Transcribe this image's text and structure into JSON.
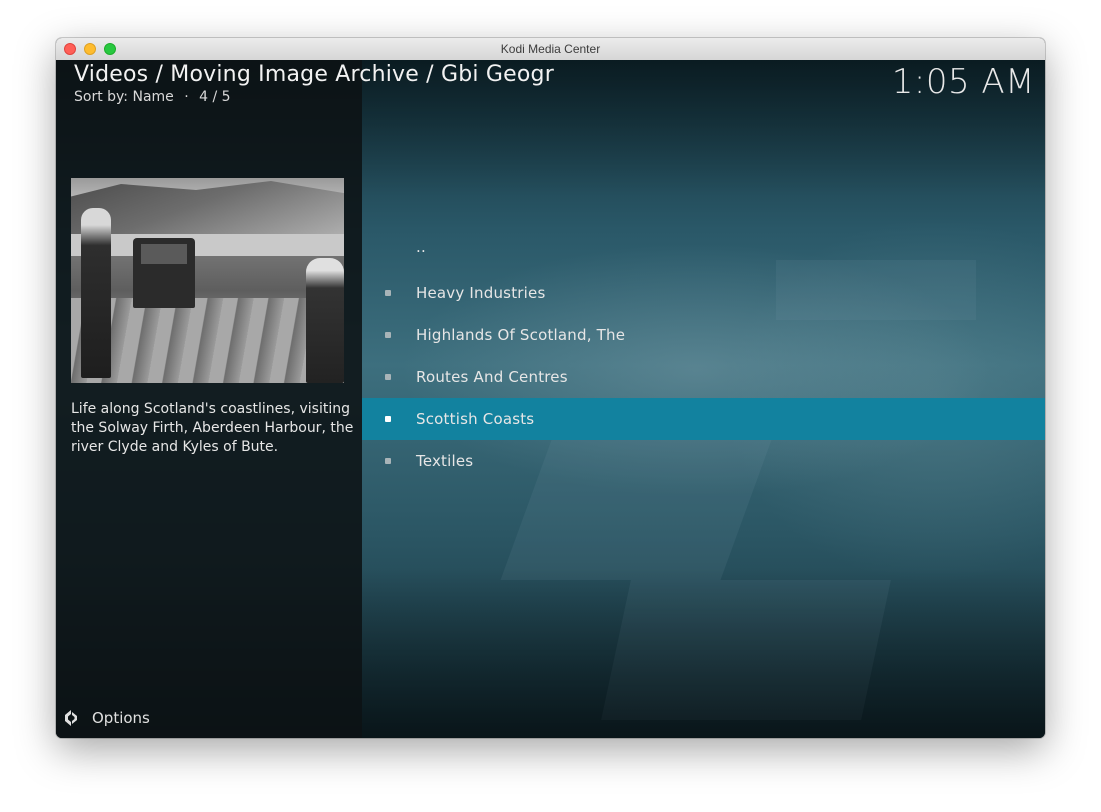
{
  "window": {
    "title": "Kodi Media Center"
  },
  "header": {
    "breadcrumb": "Videos / Moving Image Archive / Gbi Geogr",
    "sort_label": "Sort by: Name",
    "separator": "·",
    "position": "4 / 5",
    "clock": "1:05 AM"
  },
  "info": {
    "description": "Life along Scotland's coastlines, visiting the Solway Firth, Aberdeen Harbour, the river Clyde and Kyles of Bute."
  },
  "options": {
    "label": "Options",
    "icon": "options-icon"
  },
  "list": {
    "items": [
      {
        "label": "..",
        "selected": false,
        "parent": true
      },
      {
        "label": "Heavy Industries",
        "selected": false
      },
      {
        "label": "Highlands Of Scotland, The",
        "selected": false
      },
      {
        "label": "Routes And Centres",
        "selected": false
      },
      {
        "label": "Scottish Coasts",
        "selected": true
      },
      {
        "label": "Textiles",
        "selected": false
      }
    ]
  },
  "colors": {
    "selection": "#12829f",
    "panel": "#0c1214"
  }
}
